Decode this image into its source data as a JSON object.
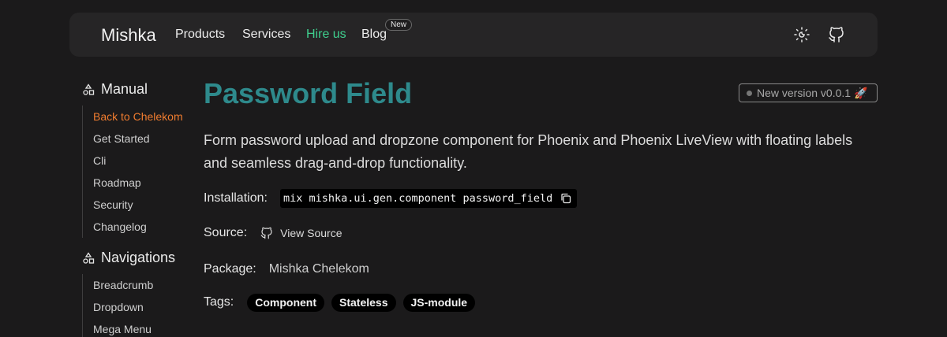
{
  "header": {
    "brand": "Mishka",
    "nav": [
      {
        "label": "Products"
      },
      {
        "label": "Services"
      },
      {
        "label": "Hire us"
      },
      {
        "label": "Blog"
      }
    ],
    "new_badge": "New",
    "icons": [
      "theme-toggle-icon",
      "github-icon"
    ],
    "hire_color": "#3fcf8e"
  },
  "sidebar": {
    "sections": [
      {
        "title": "Manual",
        "items": [
          "Back to Chelekom",
          "Get Started",
          "Cli",
          "Roadmap",
          "Security",
          "Changelog"
        ]
      },
      {
        "title": "Navigations",
        "items": [
          "Breadcrumb",
          "Dropdown",
          "Mega Menu"
        ]
      }
    ],
    "active_color": "#f07c2f"
  },
  "main": {
    "title": "Password Field",
    "title_color": "#2e8a8c",
    "version_badge": "New version v0.0.1 🚀",
    "description": "Form password upload and dropzone component for Phoenix and Phoenix LiveView with floating labels and seamless drag-and-drop functionality.",
    "installation": {
      "label": "Installation:",
      "command": "mix mishka.ui.gen.component password_field"
    },
    "source": {
      "label": "Source:",
      "link": "View Source"
    },
    "package": {
      "label": "Package:",
      "value": "Mishka Chelekom"
    },
    "tags": {
      "label": "Tags:",
      "items": [
        "Component",
        "Stateless",
        "JS-module"
      ]
    }
  }
}
